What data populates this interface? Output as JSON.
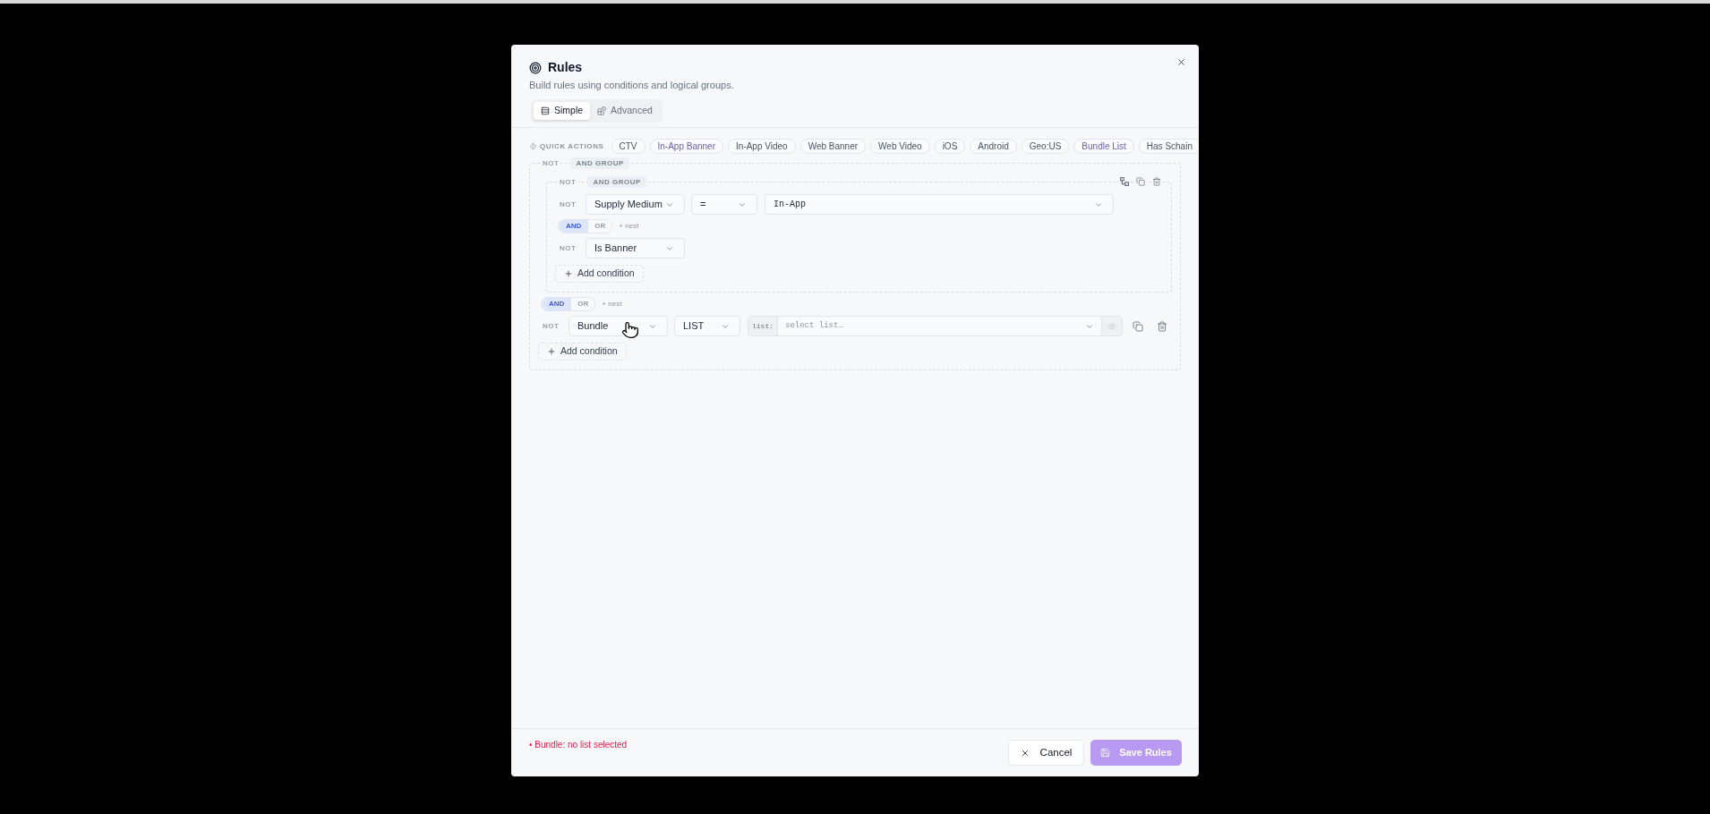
{
  "dialog": {
    "title": "Rules",
    "subtitle": "Build rules using conditions and logical groups."
  },
  "tabs": [
    {
      "label": "Simple",
      "selected": true
    },
    {
      "label": "Advanced",
      "selected": false
    }
  ],
  "quick_actions": {
    "label": "QUICK ACTIONS",
    "chips": [
      {
        "label": "CTV",
        "selected": false
      },
      {
        "label": "In-App Banner",
        "selected": true
      },
      {
        "label": "In-App Video",
        "selected": false
      },
      {
        "label": "Web Banner",
        "selected": false
      },
      {
        "label": "Web Video",
        "selected": false
      },
      {
        "label": "iOS",
        "selected": false
      },
      {
        "label": "Android",
        "selected": false
      },
      {
        "label": "Geo:US",
        "selected": false
      },
      {
        "label": "Bundle List",
        "selected": true
      },
      {
        "label": "Has Schain",
        "selected": false
      }
    ]
  },
  "rules": {
    "not_label": "NOT",
    "negated": false,
    "label": "AND GROUP",
    "show_actions": false,
    "add_label": "Add condition",
    "items": [
      {
        "kind": "group",
        "not_label": "NOT",
        "negated": false,
        "label": "AND GROUP",
        "show_actions": true,
        "add_label": "Add condition",
        "items": [
          {
            "kind": "condition",
            "not_label": "NOT",
            "negated": false,
            "field": "Supply Medium",
            "operator": "=",
            "value": {
              "kind": "select",
              "text": "In-App"
            },
            "show_actions": false
          },
          {
            "kind": "connector",
            "options": [
              {
                "label": "AND",
                "selected": true
              },
              {
                "label": "OR",
                "selected": false
              }
            ],
            "nest_label": "+ nest"
          },
          {
            "kind": "condition",
            "not_label": "NOT",
            "negated": false,
            "field": "Is Banner",
            "show_actions": false
          }
        ]
      },
      {
        "kind": "connector",
        "options": [
          {
            "label": "AND",
            "selected": true
          },
          {
            "label": "OR",
            "selected": false
          }
        ],
        "nest_label": "+ nest"
      },
      {
        "kind": "condition",
        "not_label": "NOT",
        "negated": false,
        "field": "Bundle",
        "operator": "LIST",
        "value": {
          "kind": "list",
          "prefix": "list:",
          "placeholder": "select list…"
        },
        "show_actions": true
      }
    ]
  },
  "footer": {
    "error": "• Bundle: no list selected",
    "cancel": {
      "label": "Cancel"
    },
    "save": {
      "label": "Save Rules",
      "disabled": true
    }
  }
}
